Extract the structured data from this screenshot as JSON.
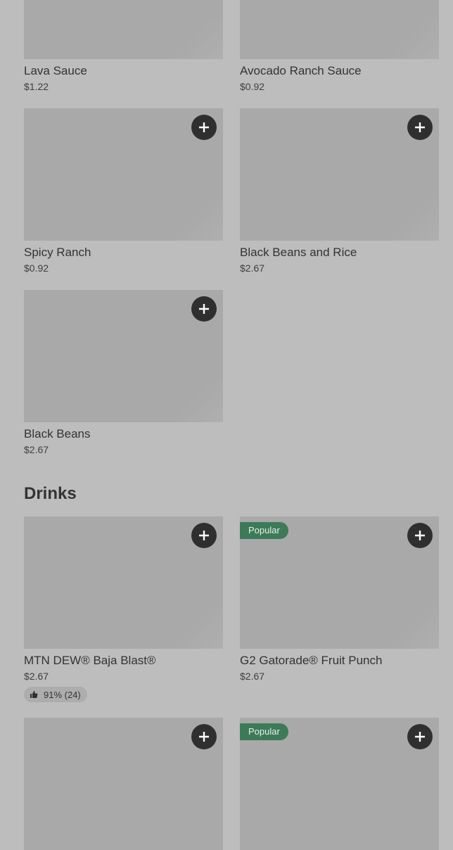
{
  "sections": [
    {
      "title": "",
      "items": [
        {
          "name": "Lava Sauce",
          "price": "$1.22"
        },
        {
          "name": "Avocado Ranch Sauce",
          "price": "$0.92"
        },
        {
          "name": "Spicy Ranch",
          "price": "$0.92"
        },
        {
          "name": "Black Beans and Rice",
          "price": "$2.67"
        },
        {
          "name": "Black Beans",
          "price": "$2.67"
        }
      ]
    },
    {
      "title": "Drinks",
      "items": [
        {
          "name": "MTN DEW® Baja Blast®",
          "price": "$2.67",
          "rating": "91% (24)"
        },
        {
          "name": "G2 Gatorade® Fruit Punch",
          "price": "$2.67",
          "badge": "Popular"
        },
        {
          "name": "",
          "price": ""
        },
        {
          "name": "",
          "price": "",
          "badge": "Popular"
        }
      ]
    }
  ],
  "icons": {
    "add": "plus-icon",
    "rating": "thumbs-up-icon"
  },
  "colors": {
    "page_background": "#bdbdbd",
    "image_placeholder": "#a9a9a9",
    "add_button": "#2f2f2f",
    "popular_badge": "#3d7a58",
    "text": "#333333"
  }
}
